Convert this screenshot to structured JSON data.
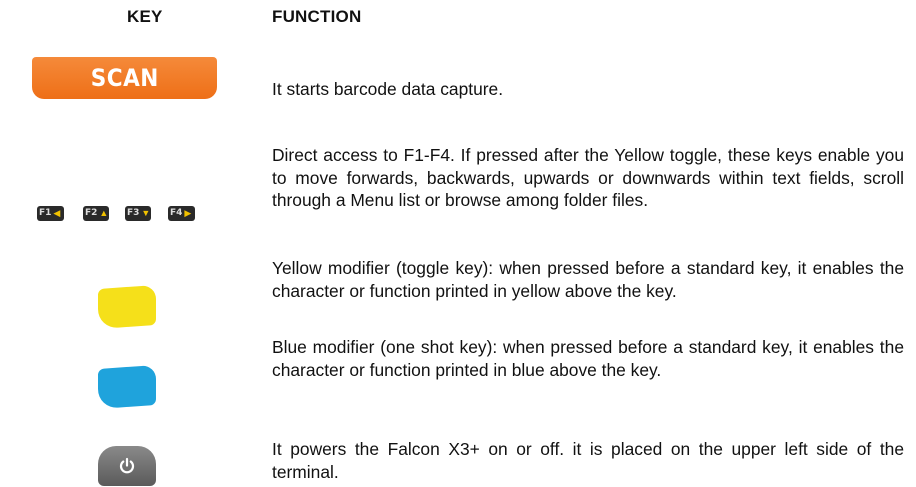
{
  "header": {
    "key": "KEY",
    "function": "FUNCTION"
  },
  "rows": [
    {
      "key_label": "SCAN",
      "icon": "scan-key-icon",
      "description": "It starts barcode data capture."
    },
    {
      "keys": [
        {
          "label": "F1",
          "arrow": "◀"
        },
        {
          "label": "F2",
          "arrow": "▲"
        },
        {
          "label": "F3",
          "arrow": "▼"
        },
        {
          "label": "F4",
          "arrow": "▶"
        }
      ],
      "icon": "function-keys-icon",
      "description": "Direct access to F1-F4. If pressed after the Yellow toggle, these keys enable you to move forwards, backwards, upwards or downwards within text fields, scroll through a Menu list or browse among folder files."
    },
    {
      "icon": "yellow-modifier-key-icon",
      "color": "#f5e01a",
      "description": "Yellow modifier (toggle key): when pressed before a standard key, it enables the character or function printed in yellow above the key."
    },
    {
      "icon": "blue-modifier-key-icon",
      "color": "#1fa3dc",
      "description": "Blue modifier (one shot key): when pressed before a standard key, it enables the character or function printed in blue above the key."
    },
    {
      "icon": "power-key-icon",
      "description": "It powers the Falcon X3+ on or off. it is placed on the upper left side of the terminal."
    }
  ]
}
